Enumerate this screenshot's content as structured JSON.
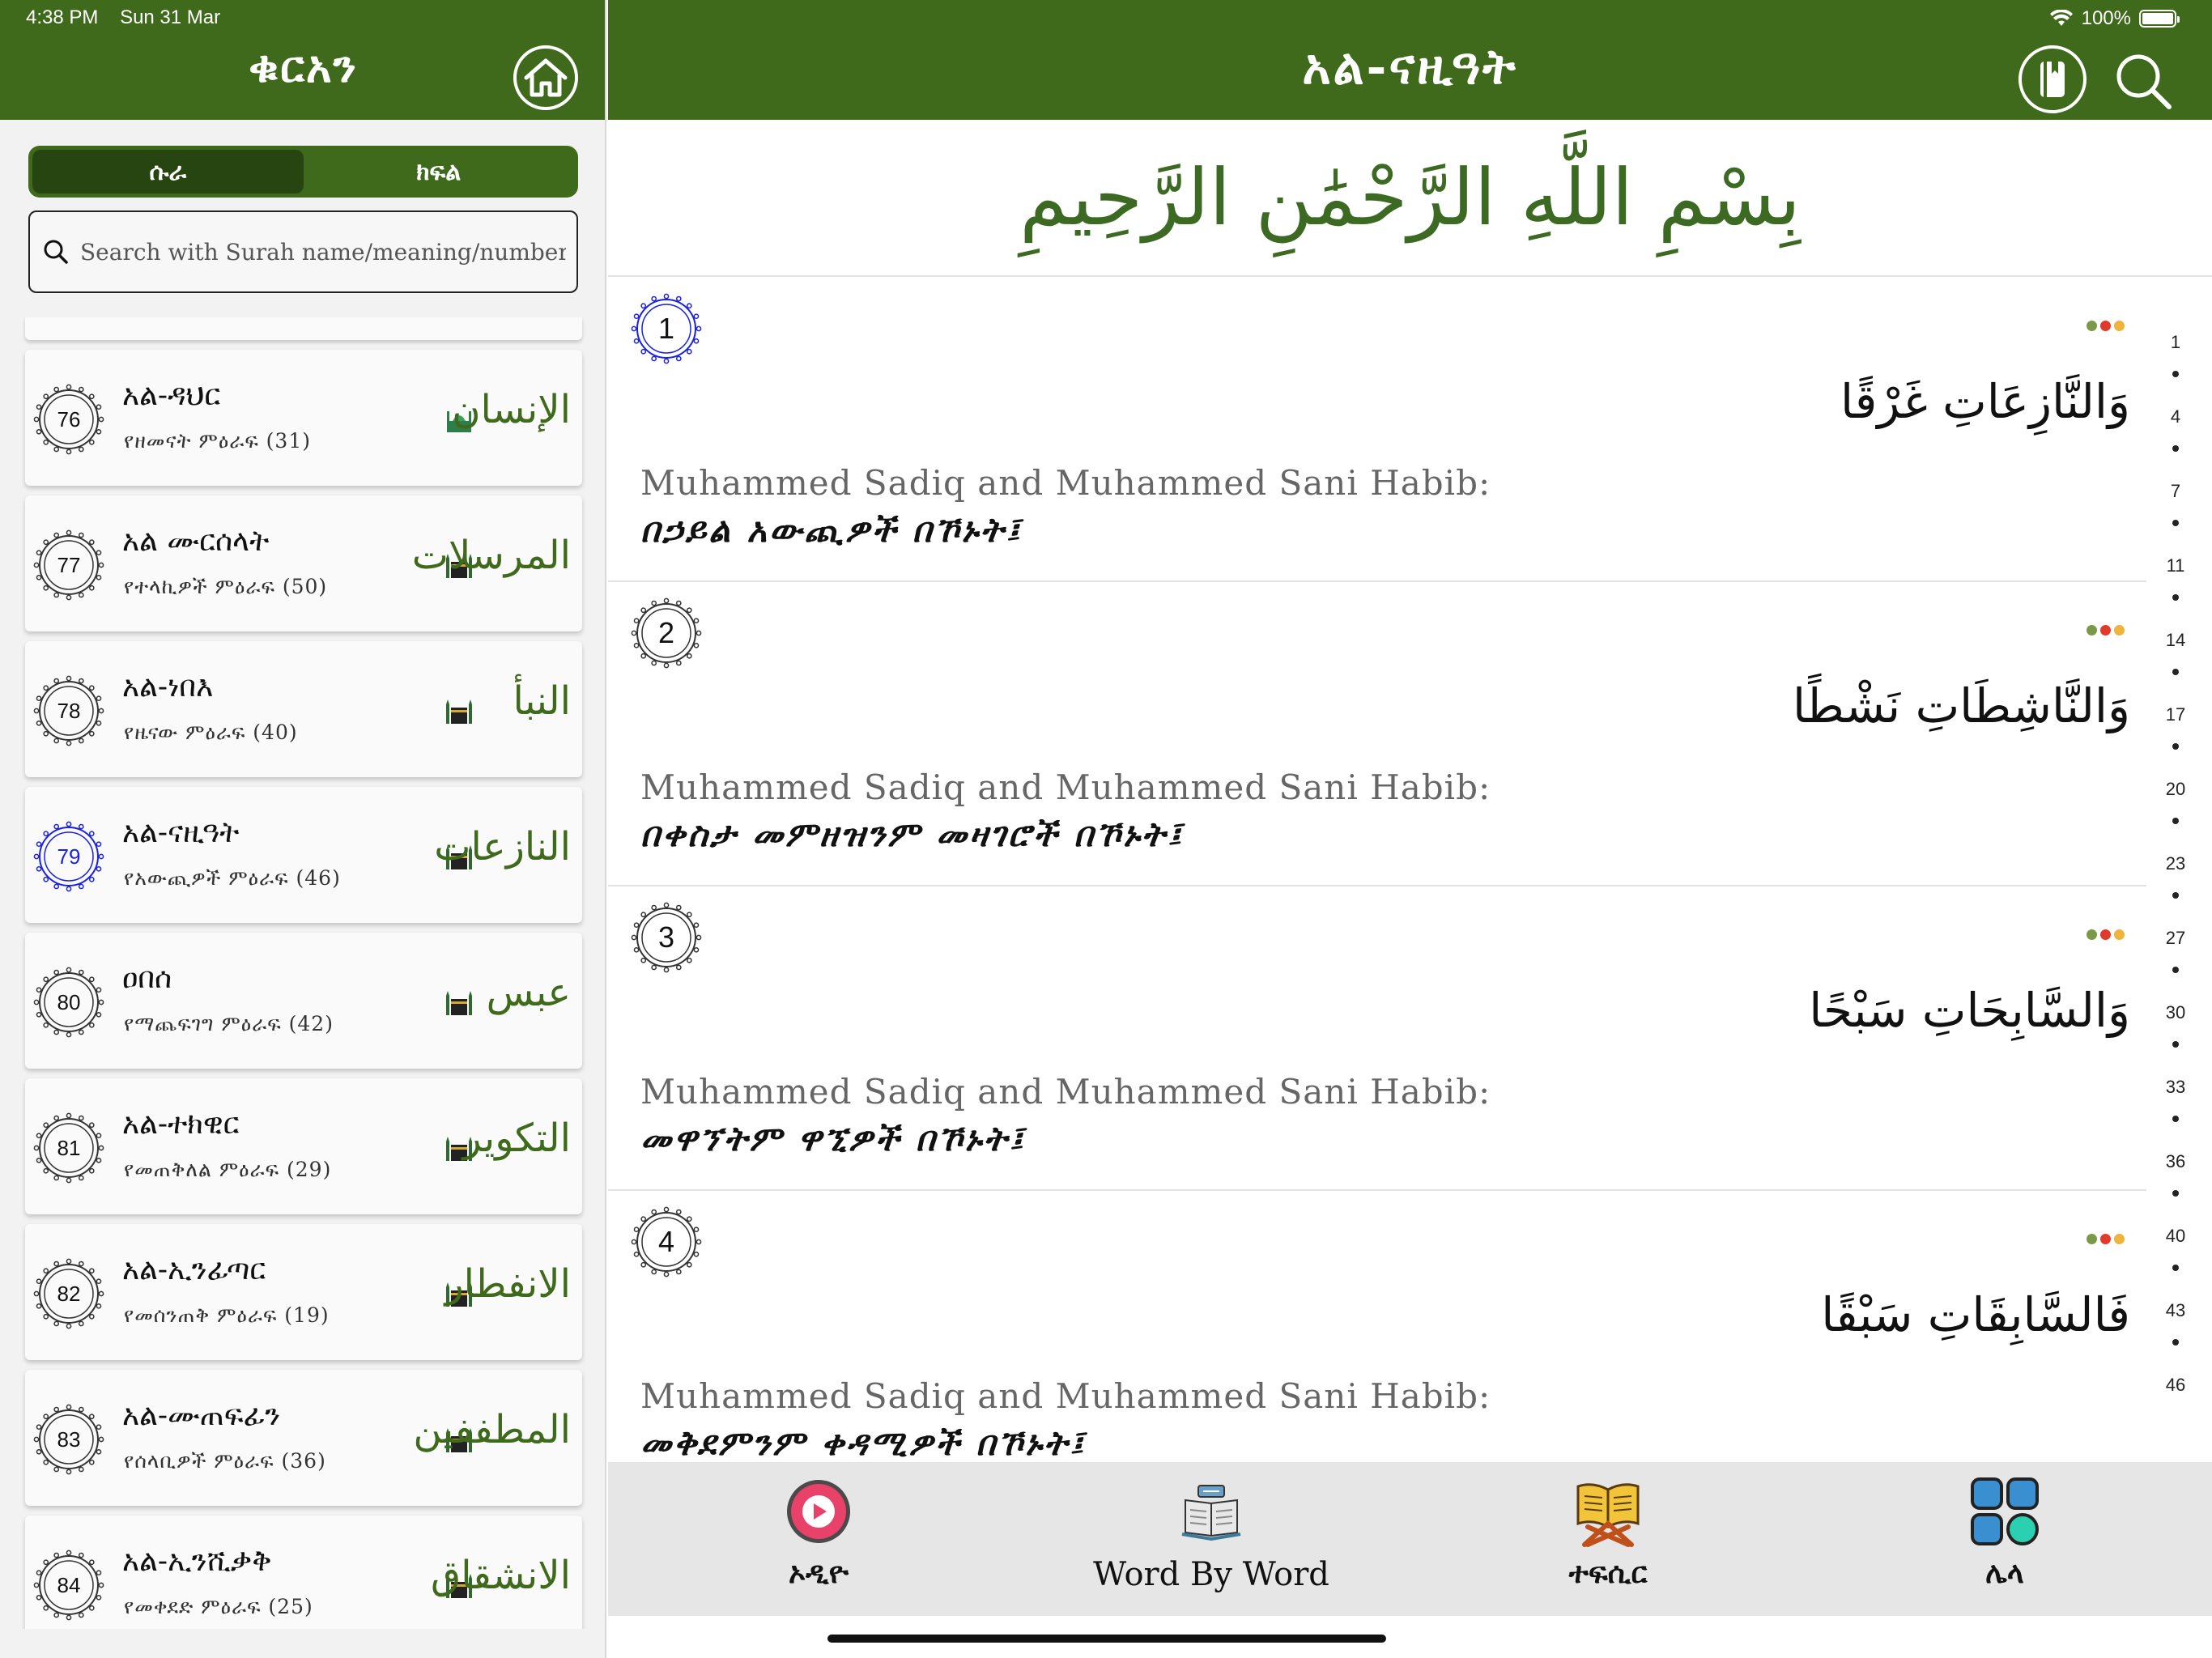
{
  "status_bar": {
    "time": "4:38 PM",
    "date": "Sun 31 Mar",
    "battery": "100%"
  },
  "left": {
    "title": "ቁርአን",
    "segments": [
      {
        "label": "ሱራ",
        "active": true
      },
      {
        "label": "ክፍል",
        "active": false
      }
    ],
    "search": {
      "placeholder": "Search with Surah name/meaning/number",
      "value": ""
    },
    "surahs": [
      {
        "number": "76",
        "name": "አል-ዳህር",
        "meta": "የዘመናት ምዕራፍ (31)",
        "arabic": "الإنسان",
        "place": "medina",
        "active": false
      },
      {
        "number": "77",
        "name": "አል ሙርሰላት",
        "meta": "የተላኪዎች ምዕራፍ (50)",
        "arabic": "المرسلات",
        "place": "mecca",
        "active": false
      },
      {
        "number": "78",
        "name": "አል-ነበእ",
        "meta": "የዜናው ምዕራፍ (40)",
        "arabic": "النبأ",
        "place": "mecca",
        "active": false
      },
      {
        "number": "79",
        "name": "አል-ናዚዓት",
        "meta": "የአውጪዎች ምዕራፍ (46)",
        "arabic": "النازعات",
        "place": "mecca",
        "active": true
      },
      {
        "number": "80",
        "name": "ዐበሰ",
        "meta": "የማጨፍገግ ምዕራፍ (42)",
        "arabic": "عبس",
        "place": "mecca",
        "active": false
      },
      {
        "number": "81",
        "name": "አል-ተክዊር",
        "meta": "የመጠቅለል ምዕራፍ (29)",
        "arabic": "التكوير",
        "place": "mecca",
        "active": false
      },
      {
        "number": "82",
        "name": "አል-ኢንፊጣር",
        "meta": "የመሰንጠቅ ምዕራፍ (19)",
        "arabic": "الانفطار",
        "place": "mecca",
        "active": false
      },
      {
        "number": "83",
        "name": "አል-ሙጠፍፊን",
        "meta": "የሰላቢዎች ምዕራፍ (36)",
        "arabic": "المطففين",
        "place": "mecca",
        "active": false
      },
      {
        "number": "84",
        "name": "አል-ኢንሺቃቅ",
        "meta": "የመቀደድ ምዕራፍ (25)",
        "arabic": "الانشقاق",
        "place": "mecca",
        "active": false
      }
    ]
  },
  "right": {
    "title": "አል-ናዚዓት",
    "bismillah": "بِسْمِ اللَّهِ الرَّحْمَٰنِ الرَّحِيمِ",
    "verses": [
      {
        "number": "1",
        "arabic": "وَالنَّازِعَاتِ غَرْقًا",
        "translator": "Muhammed Sadiq and Muhammed Sani Habib:",
        "translation": "በኃይል አውጪዎች በኾኑት፤"
      },
      {
        "number": "2",
        "arabic": "وَالنَّاشِطَاتِ نَشْطًا",
        "translator": "Muhammed Sadiq and Muhammed Sani Habib:",
        "translation": "በቀስታ መምዘዝንም መዛገሮች በኾኑት፤"
      },
      {
        "number": "3",
        "arabic": "وَالسَّابِحَاتِ سَبْحًا",
        "translator": "Muhammed Sadiq and Muhammed Sani Habib:",
        "translation": "መዋኘትም ዋኚዎች በኾኑት፤"
      },
      {
        "number": "4",
        "arabic": "فَالسَّابِقَاتِ سَبْقًا",
        "translator": "Muhammed Sadiq and Muhammed Sani Habib:",
        "translation": "መቅደምንም ቀዳሚዎች በኾኑት፤"
      }
    ],
    "dot_colors": [
      "#7a9a48",
      "#e23a2a",
      "#f0b33c"
    ],
    "verse_index": [
      "1",
      "4",
      "7",
      "11",
      "14",
      "17",
      "20",
      "23",
      "27",
      "30",
      "33",
      "36",
      "40",
      "43",
      "46"
    ],
    "tabs": [
      {
        "label": "ኦዲዮ",
        "icon": "play-icon"
      },
      {
        "label": "Word By Word",
        "icon": "word-book-icon"
      },
      {
        "label": "ተፍሲር",
        "icon": "open-quran-icon"
      },
      {
        "label": "ሌላ",
        "icon": "grid-apps-icon"
      }
    ]
  },
  "colors": {
    "header_green": "#3f6a1c",
    "dark_green": "#274510",
    "active_blue": "#1a22e0"
  }
}
